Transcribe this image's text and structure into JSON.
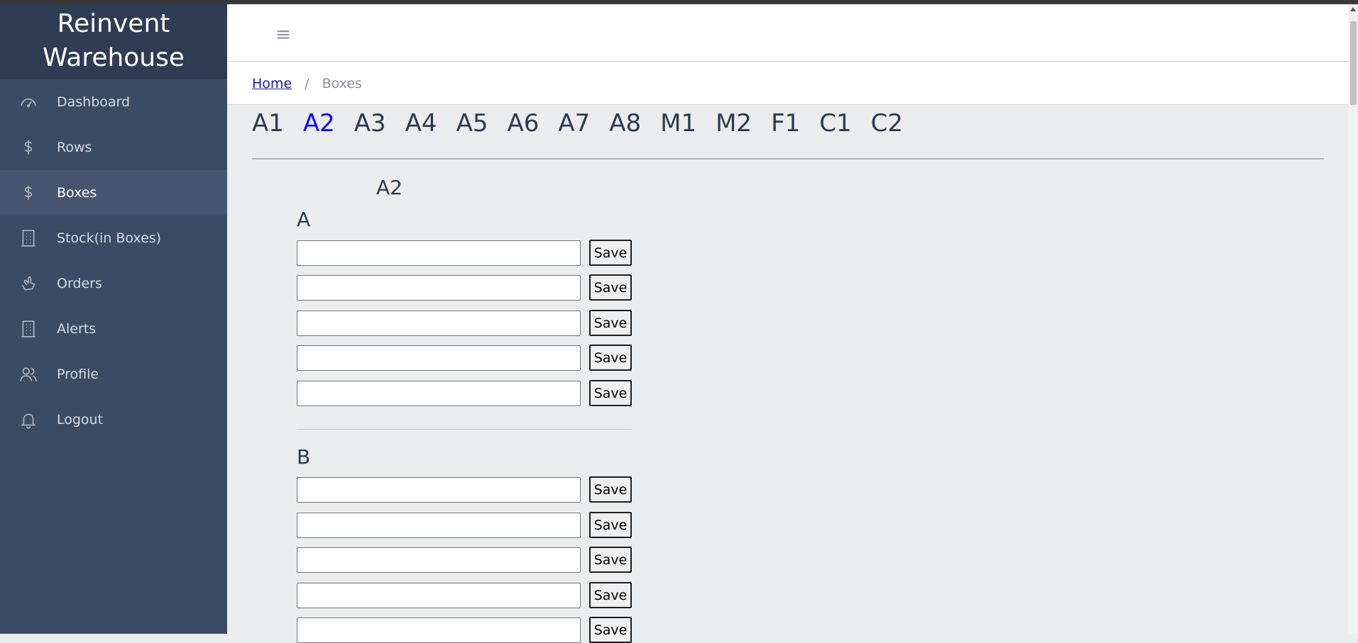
{
  "app": {
    "brand_line1": "Reinvent",
    "brand_line2": "Warehouse"
  },
  "sidebar": {
    "items": [
      {
        "label": "Dashboard",
        "icon": "speedometer-icon"
      },
      {
        "label": "Rows",
        "icon": "dollar-icon"
      },
      {
        "label": "Boxes",
        "icon": "dollar-icon",
        "active": true
      },
      {
        "label": "Stock(in Boxes)",
        "icon": "building-icon"
      },
      {
        "label": "Orders",
        "icon": "hand-icon"
      },
      {
        "label": "Alerts",
        "icon": "building-icon"
      },
      {
        "label": "Profile",
        "icon": "people-icon"
      },
      {
        "label": "Logout",
        "icon": "bell-icon"
      }
    ]
  },
  "header": {
    "menu_icon": "≡"
  },
  "breadcrumb": {
    "home": "Home",
    "separator": "/",
    "current": "Boxes"
  },
  "tabs": [
    "A1",
    "A2",
    "A3",
    "A4",
    "A5",
    "A6",
    "A7",
    "A8",
    "M1",
    "M2",
    "F1",
    "C1",
    "C2"
  ],
  "active_tab": "A2",
  "content": {
    "title": "A2",
    "sections": [
      {
        "label": "A",
        "fields": [
          "",
          "",
          "",
          "",
          ""
        ],
        "button_label": "Save"
      },
      {
        "label": "B",
        "fields": [
          "",
          "",
          "",
          "",
          ""
        ],
        "button_label": "Save"
      }
    ]
  },
  "colors": {
    "sidebar": "#3c4b64",
    "brand": "#303c54",
    "active_tab": "#0b0bee",
    "content_bg": "#ebecee"
  }
}
